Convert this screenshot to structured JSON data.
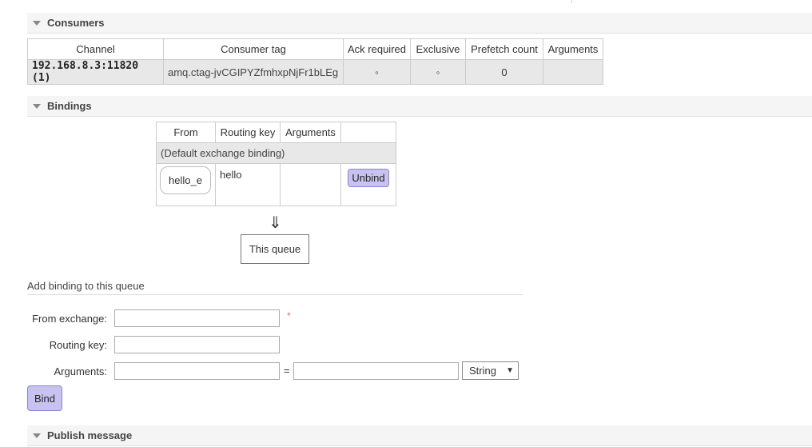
{
  "sections": {
    "consumers": "Consumers",
    "bindings": "Bindings",
    "publish": "Publish message"
  },
  "consumers_table": {
    "headers": [
      "Channel",
      "Consumer tag",
      "Ack required",
      "Exclusive",
      "Prefetch count",
      "Arguments"
    ],
    "row": {
      "channel": "192.168.8.3:11820 (1)",
      "tag": "amq.ctag-jvCGIPYZfmhxpNjFr1bLEg",
      "ack": "◦",
      "exclusive": "◦",
      "prefetch": "0",
      "arguments": ""
    }
  },
  "bindings_table": {
    "headers": [
      "From",
      "Routing key",
      "Arguments",
      ""
    ],
    "default_binding": "(Default exchange binding)",
    "row": {
      "from": "hello_e",
      "routing_key": "hello",
      "arguments": "",
      "unbind_label": "Unbind"
    }
  },
  "flow": {
    "arrow": "⇓",
    "queue_label": "This queue"
  },
  "add_binding": {
    "title": "Add binding to this queue",
    "from_label": "From exchange:",
    "routing_label": "Routing key:",
    "arguments_label": "Arguments:",
    "required_mark": "*",
    "equals": "=",
    "type_value": "String",
    "bind_label": "Bind"
  }
}
